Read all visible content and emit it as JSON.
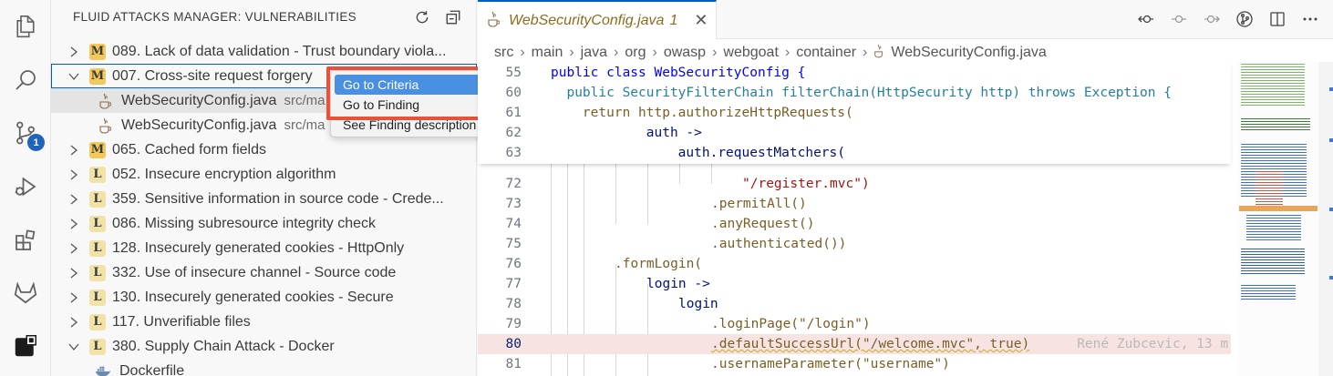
{
  "sidebar": {
    "title": "FLUID ATTACKS MANAGER: VULNERABILITIES",
    "items": [
      {
        "sev": "M",
        "label": "089. Lack of data validation - Trust boundary viola..."
      },
      {
        "sev": "M",
        "label": "007. Cross-site request forgery"
      },
      {
        "file": "WebSecurityConfig.java",
        "desc": "src/ma"
      },
      {
        "file": "WebSecurityConfig.java",
        "desc": "src/ma"
      },
      {
        "sev": "M",
        "label": "065. Cached form fields"
      },
      {
        "sev": "L",
        "label": "052. Insecure encryption algorithm"
      },
      {
        "sev": "L",
        "label": "359. Sensitive information in source code - Crede..."
      },
      {
        "sev": "L",
        "label": "086. Missing subresource integrity check"
      },
      {
        "sev": "L",
        "label": "128. Insecurely generated cookies - HttpOnly"
      },
      {
        "sev": "L",
        "label": "332. Use of insecure channel - Source code"
      },
      {
        "sev": "L",
        "label": "130. Insecurely generated cookies - Secure"
      },
      {
        "sev": "L",
        "label": "117. Unverifiable files"
      },
      {
        "sev": "L",
        "label": "380. Supply Chain Attack - Docker"
      },
      {
        "file": "Dockerfile",
        "desc": ""
      }
    ]
  },
  "activity": {
    "badge": "1"
  },
  "context_menu": {
    "items": [
      "Go to Criteria",
      "Go to Finding",
      "See Finding description"
    ]
  },
  "editor": {
    "tab": {
      "name": "WebSecurityConfig.java",
      "problems": "1",
      "close": "✕"
    },
    "breadcrumb": [
      "src",
      "main",
      "java",
      "org",
      "owasp",
      "webgoat",
      "container",
      "WebSecurityConfig.java"
    ],
    "sticky_lines": [
      {
        "n": "55",
        "code": "public class WebSecurityConfig {"
      },
      {
        "n": "60",
        "code": "  public SecurityFilterChain filterChain(HttpSecurity http) throws Exception {"
      },
      {
        "n": "61",
        "code": "    return http.authorizeHttpRequests("
      },
      {
        "n": "62",
        "code": "            auth ->"
      },
      {
        "n": "63",
        "code": "                auth.requestMatchers("
      }
    ],
    "lines": [
      {
        "n": "72",
        "code": "\"/register.mvc\")"
      },
      {
        "n": "73",
        "code": ".permitAll()"
      },
      {
        "n": "74",
        "code": ".anyRequest()"
      },
      {
        "n": "75",
        "code": ".authenticated())"
      },
      {
        "n": "76",
        "code": ".formLogin("
      },
      {
        "n": "77",
        "code": "login ->"
      },
      {
        "n": "78",
        "code": "login"
      },
      {
        "n": "79",
        "code": ".loginPage(\"/login\")"
      },
      {
        "n": "80",
        "code": ".defaultSuccessUrl(\"/welcome.mvc\", true)"
      },
      {
        "n": "81",
        "code": ".usernameParameter(\"username\")"
      }
    ],
    "blame": "René Zubcevic, 13 m"
  },
  "colors": {
    "accent": "#005fb8",
    "highlight": "#e5533b",
    "sevM": "#f2c95c",
    "sevL": "#f1e2a8"
  }
}
